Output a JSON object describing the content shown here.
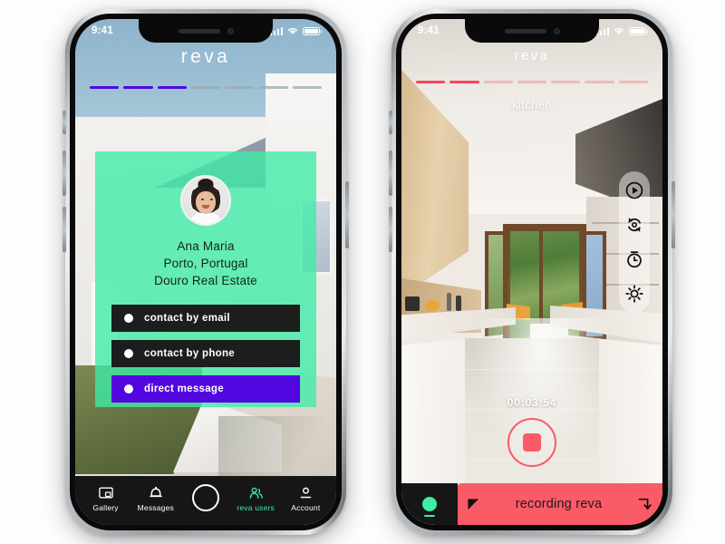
{
  "left_phone": {
    "status_bar": {
      "time": "9:41",
      "signal_icon": "signal-bars-icon",
      "wifi_icon": "wifi-icon",
      "battery_icon": "battery-icon"
    },
    "app_logo": "reva",
    "progress": {
      "total_segments": 7,
      "filled_segments": 3,
      "filled_color": "#5206e0",
      "empty_color": "#9aa9b3"
    },
    "profile_card": {
      "avatar_alt": "user-avatar",
      "name": "Ana Maria",
      "location": "Porto, Portugal",
      "company": "Douro Real Estate",
      "card_color": "#3eeca6",
      "buttons": [
        {
          "label": "contact by email",
          "style": "dark",
          "bg": "#1d1d1d"
        },
        {
          "label": "contact by phone",
          "style": "dark",
          "bg": "#1d1d1d"
        },
        {
          "label": "direct message",
          "style": "purple",
          "bg": "#5206e0"
        }
      ]
    },
    "tab_bar": {
      "active_color": "#3eeca6",
      "items": [
        {
          "label": "Gallery",
          "icon": "gallery-icon",
          "active": false
        },
        {
          "label": "Messages",
          "icon": "bell-icon",
          "active": false
        },
        {
          "label": "",
          "icon": "shutter-circle-icon",
          "active": false
        },
        {
          "label": "reva users",
          "icon": "users-icon",
          "active": true
        },
        {
          "label": "Account",
          "icon": "account-icon",
          "active": false
        }
      ]
    }
  },
  "right_phone": {
    "status_bar": {
      "time": "9:41",
      "signal_icon": "signal-bars-icon",
      "wifi_icon": "wifi-icon",
      "battery_icon": "battery-icon"
    },
    "app_logo": "reva",
    "progress": {
      "total_segments": 7,
      "filled_segments": 2,
      "filled_color": "#f4475c",
      "empty_color": "#f0a9ae"
    },
    "room_label": "kitchen",
    "controls": [
      {
        "icon": "play-circle-icon"
      },
      {
        "icon": "rotate-capture-icon"
      },
      {
        "icon": "timer-clock-icon"
      },
      {
        "icon": "brightness-sun-icon"
      }
    ],
    "recording": {
      "timer": "00:03:54",
      "stop_button_icon": "stop-square-icon",
      "stop_color": "#fb5a67",
      "status_dot_color": "#3eeca6",
      "bar_label": "recording reva",
      "bar_color": "#fb5a67",
      "left_icon": "cursor-arrow-icon",
      "right_icon": "download-arrow-icon"
    }
  }
}
